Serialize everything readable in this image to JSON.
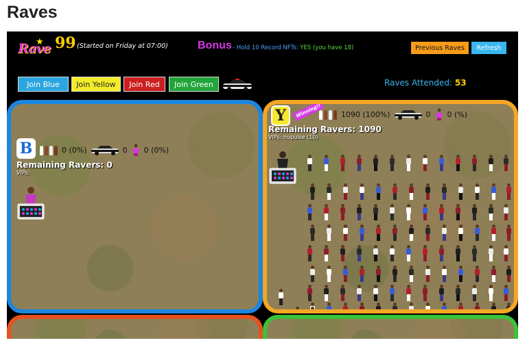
{
  "page": {
    "title": "Raves"
  },
  "header": {
    "logo_text": "Rave",
    "rave_number": "99",
    "started_text": "(Started on Friday at 07:00)",
    "bonus_title": "Bonus",
    "bonus_prefix": "- Hold 10 Record NFTs:",
    "bonus_status": "YES",
    "bonus_suffix": "(you have 18)",
    "previous_raves_label": "Previous Raves",
    "refresh_label": "Refresh"
  },
  "join": {
    "blue_label": "Join Blue",
    "yellow_label": "Join Yellow",
    "red_label": "Join Red",
    "green_label": "Join Green"
  },
  "raves_attended": {
    "label": "Raves Attended:",
    "value": "53"
  },
  "teams": {
    "blue": {
      "badge": "B",
      "ravers_stat": "0 (0%)",
      "police_stat": "0",
      "dancer_stat": "0 (0%)",
      "remaining_label": "Remaining Ravers:",
      "remaining_value": "0",
      "vips_label": "VIPs:",
      "vips_value": ""
    },
    "yellow": {
      "badge": "Y",
      "winning_label": "Winning!!",
      "ravers_stat": "1090 (100%)",
      "police_stat": "0",
      "dancer_stat": "0 (%)",
      "remaining_label": "Remaining Ravers:",
      "remaining_value": "1090",
      "vips_label": "VIPs:",
      "vips_value": "nupulse (10)"
    }
  },
  "colors": {
    "blue": "#1a86e0",
    "yellow": "#f5a623",
    "red": "#e5511f",
    "green": "#3ac23a",
    "accent_pink": "#d63ae6",
    "gold": "#ffd000"
  },
  "icons": [
    "rave-logo-icon",
    "police-car-icon",
    "ravers-group-icon",
    "dancer-icon",
    "dj-booth-icon"
  ]
}
